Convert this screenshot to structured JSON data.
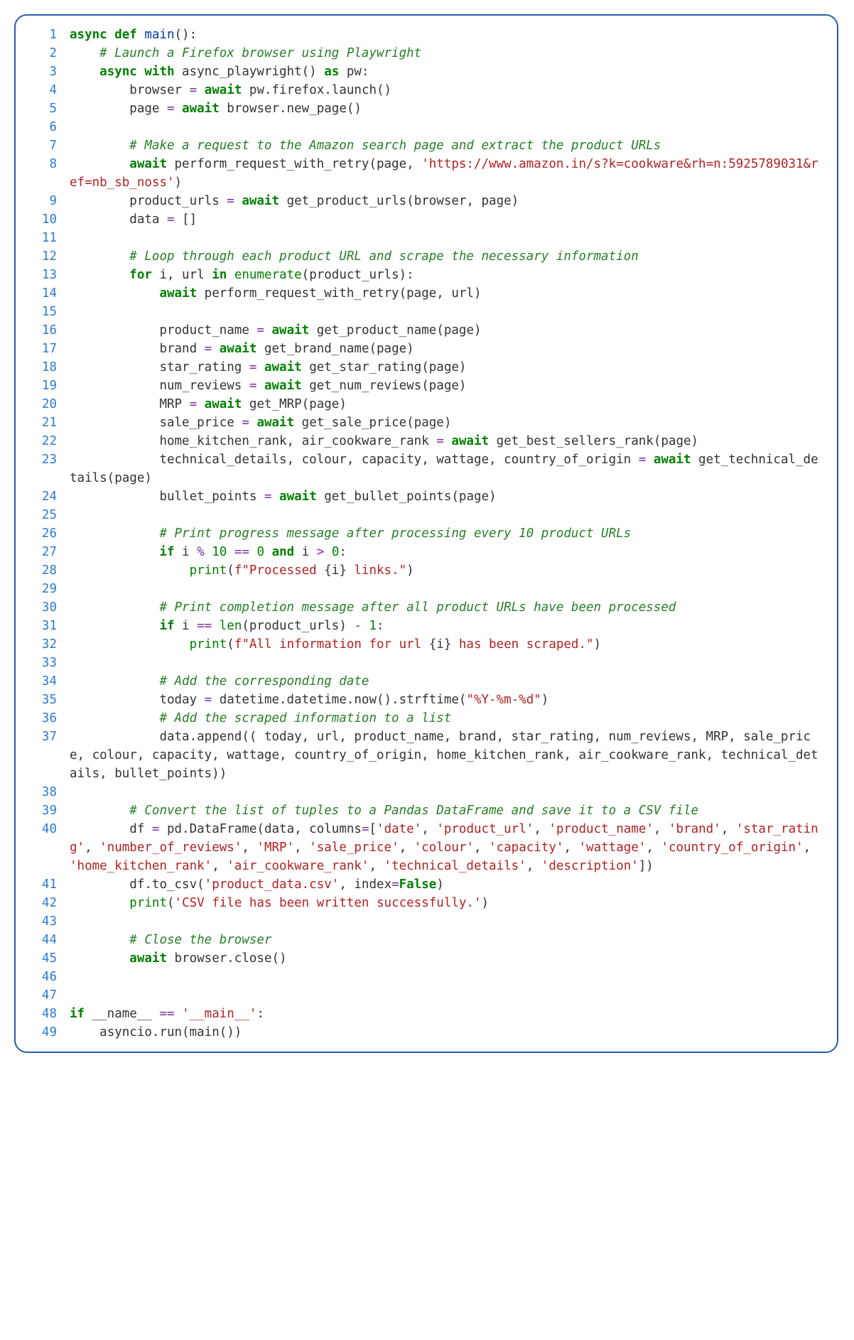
{
  "lines": [
    {
      "n": "1",
      "tokens": [
        [
          "kw",
          "async def "
        ],
        [
          "fn",
          "main"
        ],
        [
          "nm",
          "():"
        ]
      ]
    },
    {
      "n": "2",
      "tokens": [
        [
          "nm",
          "    "
        ],
        [
          "cm",
          "# Launch a Firefox browser using Playwright"
        ]
      ]
    },
    {
      "n": "3",
      "tokens": [
        [
          "nm",
          "    "
        ],
        [
          "kw",
          "async with"
        ],
        [
          "nm",
          " async_playwright() "
        ],
        [
          "kw",
          "as"
        ],
        [
          "nm",
          " pw:"
        ]
      ]
    },
    {
      "n": "4",
      "tokens": [
        [
          "nm",
          "        browser "
        ],
        [
          "op",
          "="
        ],
        [
          "nm",
          " "
        ],
        [
          "kw",
          "await"
        ],
        [
          "nm",
          " pw.firefox.launch()"
        ]
      ]
    },
    {
      "n": "5",
      "tokens": [
        [
          "nm",
          "        page "
        ],
        [
          "op",
          "="
        ],
        [
          "nm",
          " "
        ],
        [
          "kw",
          "await"
        ],
        [
          "nm",
          " browser.new_page()"
        ]
      ]
    },
    {
      "n": "6",
      "tokens": [
        [
          "nm",
          ""
        ]
      ]
    },
    {
      "n": "7",
      "tokens": [
        [
          "nm",
          "        "
        ],
        [
          "cm",
          "# Make a request to the Amazon search page and extract the product URLs"
        ]
      ]
    },
    {
      "n": "8",
      "tokens": [
        [
          "nm",
          "        "
        ],
        [
          "kw",
          "await"
        ],
        [
          "nm",
          " perform_request_with_retry(page, "
        ],
        [
          "str",
          "'https://www.amazon.in/s?k=cookware&rh=n:5925789031&ref=nb_sb_noss'"
        ],
        [
          "nm",
          ")"
        ]
      ]
    },
    {
      "n": "9",
      "tokens": [
        [
          "nm",
          "        product_urls "
        ],
        [
          "op",
          "="
        ],
        [
          "nm",
          " "
        ],
        [
          "kw",
          "await"
        ],
        [
          "nm",
          " get_product_urls(browser, page)"
        ]
      ]
    },
    {
      "n": "10",
      "tokens": [
        [
          "nm",
          "        data "
        ],
        [
          "op",
          "="
        ],
        [
          "nm",
          " []"
        ]
      ]
    },
    {
      "n": "11",
      "tokens": [
        [
          "nm",
          ""
        ]
      ]
    },
    {
      "n": "12",
      "tokens": [
        [
          "nm",
          "        "
        ],
        [
          "cm",
          "# Loop through each product URL and scrape the necessary information"
        ]
      ]
    },
    {
      "n": "13",
      "tokens": [
        [
          "nm",
          "        "
        ],
        [
          "kw",
          "for"
        ],
        [
          "nm",
          " i, url "
        ],
        [
          "kw",
          "in"
        ],
        [
          "nm",
          " "
        ],
        [
          "bi",
          "enumerate"
        ],
        [
          "nm",
          "(product_urls):"
        ]
      ]
    },
    {
      "n": "14",
      "tokens": [
        [
          "nm",
          "            "
        ],
        [
          "kw",
          "await"
        ],
        [
          "nm",
          " perform_request_with_retry(page, url)"
        ]
      ]
    },
    {
      "n": "15",
      "tokens": [
        [
          "nm",
          ""
        ]
      ]
    },
    {
      "n": "16",
      "tokens": [
        [
          "nm",
          "            product_name "
        ],
        [
          "op",
          "="
        ],
        [
          "nm",
          " "
        ],
        [
          "kw",
          "await"
        ],
        [
          "nm",
          " get_product_name(page)"
        ]
      ]
    },
    {
      "n": "17",
      "tokens": [
        [
          "nm",
          "            brand "
        ],
        [
          "op",
          "="
        ],
        [
          "nm",
          " "
        ],
        [
          "kw",
          "await"
        ],
        [
          "nm",
          " get_brand_name(page)"
        ]
      ]
    },
    {
      "n": "18",
      "tokens": [
        [
          "nm",
          "            star_rating "
        ],
        [
          "op",
          "="
        ],
        [
          "nm",
          " "
        ],
        [
          "kw",
          "await"
        ],
        [
          "nm",
          " get_star_rating(page)"
        ]
      ]
    },
    {
      "n": "19",
      "tokens": [
        [
          "nm",
          "            num_reviews "
        ],
        [
          "op",
          "="
        ],
        [
          "nm",
          " "
        ],
        [
          "kw",
          "await"
        ],
        [
          "nm",
          " get_num_reviews(page)"
        ]
      ]
    },
    {
      "n": "20",
      "tokens": [
        [
          "nm",
          "            MRP "
        ],
        [
          "op",
          "="
        ],
        [
          "nm",
          " "
        ],
        [
          "kw",
          "await"
        ],
        [
          "nm",
          " get_MRP(page)"
        ]
      ]
    },
    {
      "n": "21",
      "tokens": [
        [
          "nm",
          "            sale_price "
        ],
        [
          "op",
          "="
        ],
        [
          "nm",
          " "
        ],
        [
          "kw",
          "await"
        ],
        [
          "nm",
          " get_sale_price(page)"
        ]
      ]
    },
    {
      "n": "22",
      "tokens": [
        [
          "nm",
          "            home_kitchen_rank, air_cookware_rank "
        ],
        [
          "op",
          "="
        ],
        [
          "nm",
          " "
        ],
        [
          "kw",
          "await"
        ],
        [
          "nm",
          " get_best_sellers_rank(page)"
        ]
      ]
    },
    {
      "n": "23",
      "tokens": [
        [
          "nm",
          "            technical_details, colour, capacity, wattage, country_of_origin "
        ],
        [
          "op",
          "="
        ],
        [
          "nm",
          " "
        ],
        [
          "kw",
          "await"
        ],
        [
          "nm",
          " get_technical_details(page)"
        ]
      ]
    },
    {
      "n": "24",
      "tokens": [
        [
          "nm",
          "            bullet_points "
        ],
        [
          "op",
          "="
        ],
        [
          "nm",
          " "
        ],
        [
          "kw",
          "await"
        ],
        [
          "nm",
          " get_bullet_points(page)"
        ]
      ]
    },
    {
      "n": "25",
      "tokens": [
        [
          "nm",
          ""
        ]
      ]
    },
    {
      "n": "26",
      "tokens": [
        [
          "nm",
          "            "
        ],
        [
          "cm",
          "# Print progress message after processing every 10 product URLs"
        ]
      ]
    },
    {
      "n": "27",
      "tokens": [
        [
          "nm",
          "            "
        ],
        [
          "kw",
          "if"
        ],
        [
          "nm",
          " i "
        ],
        [
          "op",
          "%"
        ],
        [
          "nm",
          " "
        ],
        [
          "num",
          "10"
        ],
        [
          "nm",
          " "
        ],
        [
          "op",
          "=="
        ],
        [
          "nm",
          " "
        ],
        [
          "num",
          "0"
        ],
        [
          "nm",
          " "
        ],
        [
          "kw",
          "and"
        ],
        [
          "nm",
          " i "
        ],
        [
          "op",
          ">"
        ],
        [
          "nm",
          " "
        ],
        [
          "num",
          "0"
        ],
        [
          "nm",
          ":"
        ]
      ]
    },
    {
      "n": "28",
      "tokens": [
        [
          "nm",
          "                "
        ],
        [
          "bi",
          "print"
        ],
        [
          "nm",
          "("
        ],
        [
          "str",
          "f\"Processed "
        ],
        [
          "nm",
          "{i}"
        ],
        [
          "str",
          " links.\""
        ],
        [
          "nm",
          ")"
        ]
      ]
    },
    {
      "n": "29",
      "tokens": [
        [
          "nm",
          ""
        ]
      ]
    },
    {
      "n": "30",
      "tokens": [
        [
          "nm",
          "            "
        ],
        [
          "cm",
          "# Print completion message after all product URLs have been processed"
        ]
      ]
    },
    {
      "n": "31",
      "tokens": [
        [
          "nm",
          "            "
        ],
        [
          "kw",
          "if"
        ],
        [
          "nm",
          " i "
        ],
        [
          "op",
          "=="
        ],
        [
          "nm",
          " "
        ],
        [
          "bi",
          "len"
        ],
        [
          "nm",
          "(product_urls) "
        ],
        [
          "op",
          "-"
        ],
        [
          "nm",
          " "
        ],
        [
          "num",
          "1"
        ],
        [
          "nm",
          ":"
        ]
      ]
    },
    {
      "n": "32",
      "tokens": [
        [
          "nm",
          "                "
        ],
        [
          "bi",
          "print"
        ],
        [
          "nm",
          "("
        ],
        [
          "str",
          "f\"All information for url "
        ],
        [
          "nm",
          "{i}"
        ],
        [
          "str",
          " has been scraped.\""
        ],
        [
          "nm",
          ")"
        ]
      ]
    },
    {
      "n": "33",
      "tokens": [
        [
          "nm",
          ""
        ]
      ]
    },
    {
      "n": "34",
      "tokens": [
        [
          "nm",
          "            "
        ],
        [
          "cm",
          "# Add the corresponding date"
        ]
      ]
    },
    {
      "n": "35",
      "tokens": [
        [
          "nm",
          "            today "
        ],
        [
          "op",
          "="
        ],
        [
          "nm",
          " datetime.datetime.now().strftime("
        ],
        [
          "str",
          "\"%Y-%m-%d\""
        ],
        [
          "nm",
          ")"
        ]
      ]
    },
    {
      "n": "36",
      "tokens": [
        [
          "nm",
          "            "
        ],
        [
          "cm",
          "# Add the scraped information to a list"
        ]
      ]
    },
    {
      "n": "37",
      "tokens": [
        [
          "nm",
          "            data.append(( today, url, product_name, brand, star_rating, num_reviews, MRP, sale_price, colour, capacity, wattage, country_of_origin, home_kitchen_rank, air_cookware_rank, technical_details, bullet_points))"
        ]
      ]
    },
    {
      "n": "38",
      "tokens": [
        [
          "nm",
          ""
        ]
      ]
    },
    {
      "n": "39",
      "tokens": [
        [
          "nm",
          "        "
        ],
        [
          "cm",
          "# Convert the list of tuples to a Pandas DataFrame and save it to a CSV file"
        ]
      ]
    },
    {
      "n": "40",
      "tokens": [
        [
          "nm",
          "        df "
        ],
        [
          "op",
          "="
        ],
        [
          "nm",
          " pd.DataFrame(data, columns"
        ],
        [
          "op",
          "="
        ],
        [
          "nm",
          "["
        ],
        [
          "str",
          "'date'"
        ],
        [
          "nm",
          ", "
        ],
        [
          "str",
          "'product_url'"
        ],
        [
          "nm",
          ", "
        ],
        [
          "str",
          "'product_name'"
        ],
        [
          "nm",
          ", "
        ],
        [
          "str",
          "'brand'"
        ],
        [
          "nm",
          ", "
        ],
        [
          "str",
          "'star_rating'"
        ],
        [
          "nm",
          ", "
        ],
        [
          "str",
          "'number_of_reviews'"
        ],
        [
          "nm",
          ", "
        ],
        [
          "str",
          "'MRP'"
        ],
        [
          "nm",
          ", "
        ],
        [
          "str",
          "'sale_price'"
        ],
        [
          "nm",
          ", "
        ],
        [
          "str",
          "'colour'"
        ],
        [
          "nm",
          ", "
        ],
        [
          "str",
          "'capacity'"
        ],
        [
          "nm",
          ", "
        ],
        [
          "str",
          "'wattage'"
        ],
        [
          "nm",
          ", "
        ],
        [
          "str",
          "'country_of_origin'"
        ],
        [
          "nm",
          ", "
        ],
        [
          "str",
          "'home_kitchen_rank'"
        ],
        [
          "nm",
          ", "
        ],
        [
          "str",
          "'air_cookware_rank'"
        ],
        [
          "nm",
          ", "
        ],
        [
          "str",
          "'technical_details'"
        ],
        [
          "nm",
          ", "
        ],
        [
          "str",
          "'description'"
        ],
        [
          "nm",
          "])"
        ]
      ]
    },
    {
      "n": "41",
      "tokens": [
        [
          "nm",
          "        df.to_csv("
        ],
        [
          "str",
          "'product_data.csv'"
        ],
        [
          "nm",
          ", index"
        ],
        [
          "op",
          "="
        ],
        [
          "kw3",
          "False"
        ],
        [
          "nm",
          ")"
        ]
      ]
    },
    {
      "n": "42",
      "tokens": [
        [
          "nm",
          "        "
        ],
        [
          "bi",
          "print"
        ],
        [
          "nm",
          "("
        ],
        [
          "str",
          "'CSV file has been written successfully.'"
        ],
        [
          "nm",
          ")"
        ]
      ]
    },
    {
      "n": "43",
      "tokens": [
        [
          "nm",
          ""
        ]
      ]
    },
    {
      "n": "44",
      "tokens": [
        [
          "nm",
          "        "
        ],
        [
          "cm",
          "# Close the browser"
        ]
      ]
    },
    {
      "n": "45",
      "tokens": [
        [
          "nm",
          "        "
        ],
        [
          "kw",
          "await"
        ],
        [
          "nm",
          " browser.close()"
        ]
      ]
    },
    {
      "n": "46",
      "tokens": [
        [
          "nm",
          ""
        ]
      ]
    },
    {
      "n": "47",
      "tokens": [
        [
          "nm",
          ""
        ]
      ]
    },
    {
      "n": "48",
      "tokens": [
        [
          "kw",
          "if"
        ],
        [
          "nm",
          " __name__ "
        ],
        [
          "op",
          "=="
        ],
        [
          "nm",
          " "
        ],
        [
          "str",
          "'__main__'"
        ],
        [
          "nm",
          ":"
        ]
      ]
    },
    {
      "n": "49",
      "tokens": [
        [
          "nm",
          "    asyncio.run(main())"
        ]
      ]
    }
  ]
}
